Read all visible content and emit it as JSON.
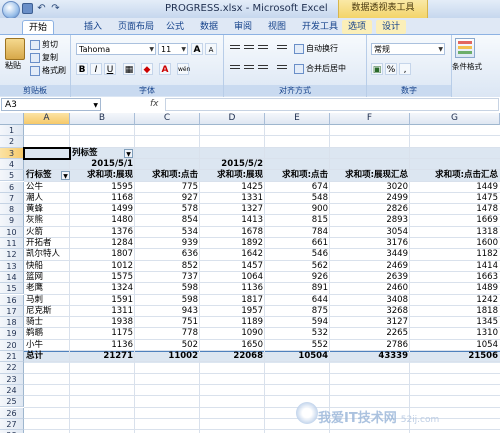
{
  "window": {
    "title": "PROGRESS.xlsx - Microsoft Excel",
    "context_tool": "数据透视表工具"
  },
  "tabs": [
    "开始",
    "插入",
    "页面布局",
    "公式",
    "数据",
    "审阅",
    "视图",
    "开发工具",
    "选项",
    "设计"
  ],
  "ribbon": {
    "clipboard": {
      "label": "剪贴板",
      "paste": "粘贴",
      "cut": "剪切",
      "copy": "复制",
      "format_painter": "格式刷"
    },
    "font": {
      "label": "字体",
      "name": "Tahoma",
      "size": "11",
      "bold": "B",
      "italic": "I",
      "underline": "U",
      "grow": "A",
      "shrink": "A",
      "color": "A",
      "phonetic": "wén"
    },
    "alignment": {
      "label": "对齐方式",
      "wrap": "自动换行",
      "merge": "合并后居中"
    },
    "number": {
      "label": "数字",
      "format": "常规",
      "percent": "%",
      "comma": ","
    },
    "styles": {
      "conditional": "条件格式"
    }
  },
  "formula_bar": {
    "cell_ref": "A3",
    "fx": "fx",
    "value": ""
  },
  "columns": [
    "A",
    "B",
    "C",
    "D",
    "E",
    "F",
    "G"
  ],
  "rows": [
    "1",
    "2",
    "3",
    "4",
    "5",
    "6",
    "7",
    "8",
    "9",
    "10",
    "11",
    "12",
    "13",
    "14",
    "15",
    "16",
    "17",
    "18",
    "19",
    "20",
    "21",
    "22",
    "23",
    "24",
    "25",
    "26",
    "27",
    "28"
  ],
  "pivot": {
    "col_label": "列标签",
    "row_label": "行标签",
    "dates": [
      "2015/5/1",
      "2015/5/2"
    ],
    "measures": [
      "求和项:展现",
      "求和项:点击",
      "求和项:展现",
      "求和项:点击",
      "求和项:展现汇总",
      "求和项:点击汇总"
    ],
    "rows": [
      [
        "公牛",
        "1595",
        "775",
        "1425",
        "674",
        "3020",
        "1449"
      ],
      [
        "潮人",
        "1168",
        "927",
        "1331",
        "548",
        "2499",
        "1475"
      ],
      [
        "黄蜂",
        "1499",
        "578",
        "1327",
        "900",
        "2826",
        "1478"
      ],
      [
        "灰熊",
        "1480",
        "854",
        "1413",
        "815",
        "2893",
        "1669"
      ],
      [
        "火箭",
        "1376",
        "534",
        "1678",
        "784",
        "3054",
        "1318"
      ],
      [
        "开拓者",
        "1284",
        "939",
        "1892",
        "661",
        "3176",
        "1600"
      ],
      [
        "凯尔特人",
        "1807",
        "636",
        "1642",
        "546",
        "3449",
        "1182"
      ],
      [
        "快船",
        "1012",
        "852",
        "1457",
        "562",
        "2469",
        "1414"
      ],
      [
        "篮网",
        "1575",
        "737",
        "1064",
        "926",
        "2639",
        "1663"
      ],
      [
        "老鹰",
        "1324",
        "598",
        "1136",
        "891",
        "2460",
        "1489"
      ],
      [
        "马刺",
        "1591",
        "598",
        "1817",
        "644",
        "3408",
        "1242"
      ],
      [
        "尼克斯",
        "1311",
        "943",
        "1957",
        "875",
        "3268",
        "1818"
      ],
      [
        "骑士",
        "1938",
        "751",
        "1189",
        "594",
        "3127",
        "1345"
      ],
      [
        "鹈鹕",
        "1175",
        "778",
        "1090",
        "532",
        "2265",
        "1310"
      ],
      [
        "小牛",
        "1136",
        "502",
        "1650",
        "552",
        "2786",
        "1054"
      ]
    ],
    "total": [
      "总计",
      "21271",
      "11002",
      "22068",
      "10504",
      "43339",
      "21506"
    ]
  },
  "watermark": {
    "text": "我爱IT技术网",
    "url": "52ij.com"
  }
}
